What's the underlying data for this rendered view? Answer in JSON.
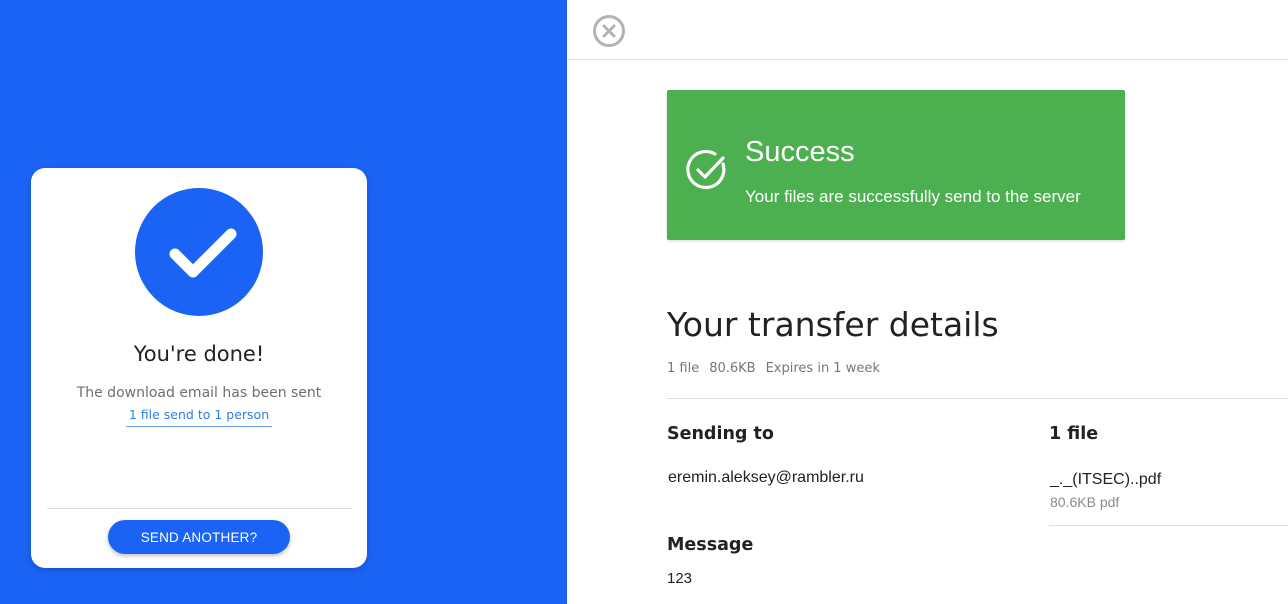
{
  "done_card": {
    "title": "You're done!",
    "subtitle": "The download email has been sent",
    "link": "1 file send to 1 person",
    "button_label": "SEND ANOTHER?"
  },
  "alert": {
    "title": "Success",
    "message": "Your files are successfully send to the server"
  },
  "details": {
    "title": "Your transfer details",
    "meta": {
      "file_count": "1 file",
      "size": "80.6KB",
      "expires": "Expires in 1 week"
    },
    "sending_to_label": "Sending to",
    "recipient": "eremin.aleksey@rambler.ru",
    "message_label": "Message",
    "message": "123",
    "files_label": "1 file",
    "file": {
      "name": "_._(ITSEC)..pdf",
      "info": "80.6KB pdf"
    }
  },
  "colors": {
    "brand_blue": "#1a63f5",
    "success_green": "#4caf50",
    "link_blue": "#2f7de1"
  },
  "icons": {
    "done": "checkmark-icon",
    "close": "close-circle-icon",
    "success": "check-circle-icon"
  }
}
